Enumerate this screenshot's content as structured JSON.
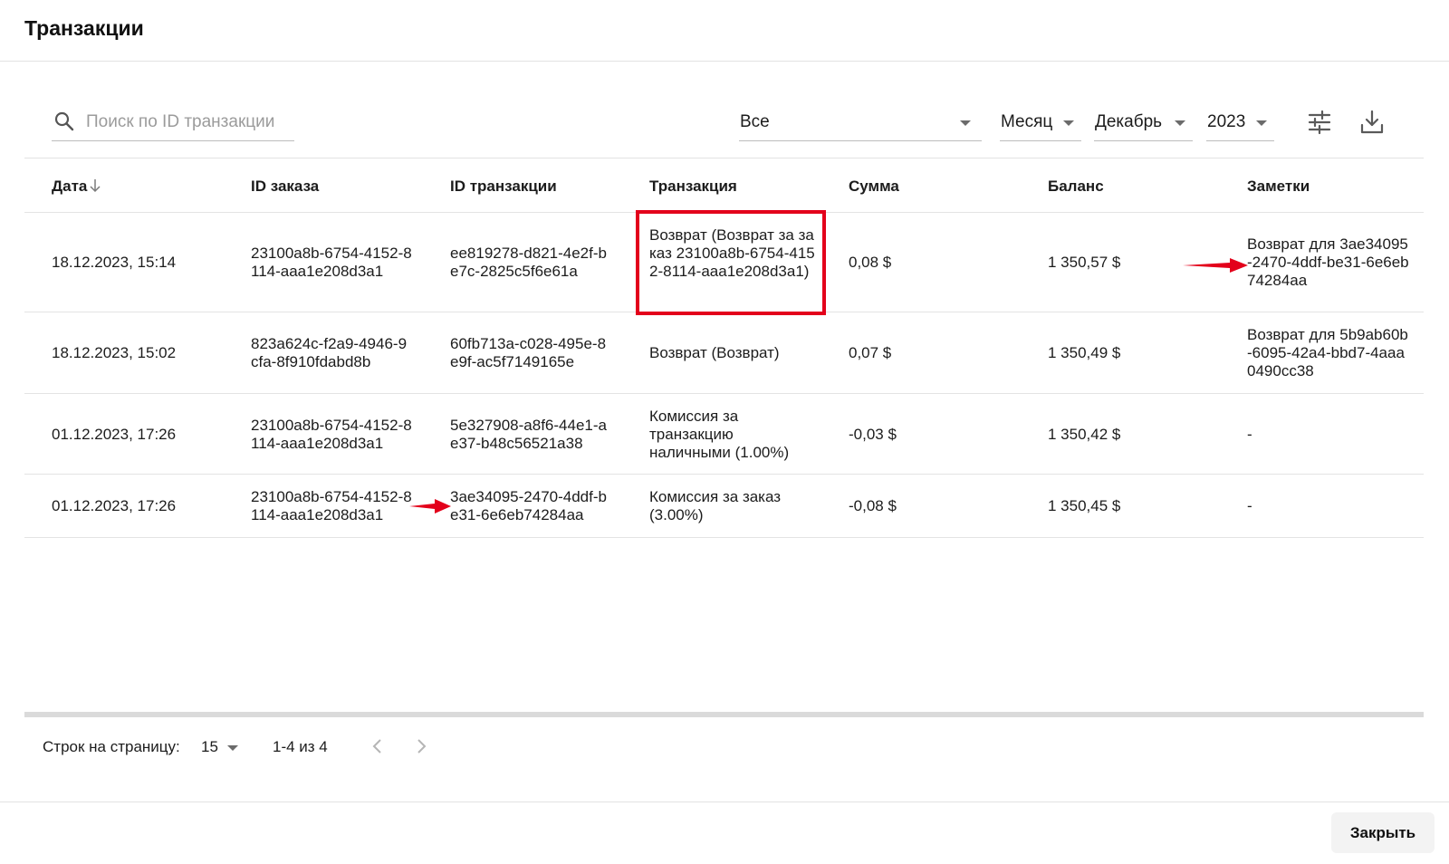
{
  "window": {
    "title": "Транзакции"
  },
  "filters": {
    "search_placeholder": "Поиск по ID транзакции",
    "search_value": "",
    "type": "Все",
    "period": "Месяц",
    "month": "Декабрь",
    "year": "2023"
  },
  "icons": {
    "search": "search-icon",
    "filter": "tune-icon",
    "download": "download-icon",
    "sort": "arrow-down-icon",
    "prev": "chevron-left-icon",
    "next": "chevron-right-icon"
  },
  "table": {
    "columns": [
      "Дата",
      "ID заказа",
      "ID транзакции",
      "Транзакция",
      "Сумма",
      "Баланс",
      "Заметки"
    ],
    "rows": [
      {
        "date": "18.12.2023, 15:14",
        "order_id": "23100a8b-6754-4152-8114-aaa1e208d3a1",
        "tx_id": "ee819278-d821-4e2f-be7c-2825c5f6e61a",
        "type": "Возврат (Возврат за заказ 23100a8b-6754-4152-8114-aaa1e208d3a1)",
        "amount": "0,08 $",
        "balance": "1 350,57 $",
        "notes": "Возврат для 3ae34095-2470-4ddf-be31-6e6eb74284aa"
      },
      {
        "date": "18.12.2023, 15:02",
        "order_id": "823a624c-f2a9-4946-9cfa-8f910fdabd8b",
        "tx_id": "60fb713a-c028-495e-8e9f-ac5f7149165e",
        "type": "Возврат (Возврат)",
        "amount": "0,07 $",
        "balance": "1 350,49 $",
        "notes": "Возврат для 5b9ab60b-6095-42a4-bbd7-4aaa0490cc38"
      },
      {
        "date": "01.12.2023, 17:26",
        "order_id": "23100a8b-6754-4152-8114-aaa1e208d3a1",
        "tx_id": "5e327908-a8f6-44e1-ae37-b48c56521a38",
        "type": "Комиссия за транзакцию наличными (1.00%)",
        "amount": "-0,03 $",
        "balance": "1 350,42 $",
        "notes": "-"
      },
      {
        "date": "01.12.2023, 17:26",
        "order_id": "23100a8b-6754-4152-8114-aaa1e208d3a1",
        "tx_id": "3ae34095-2470-4ddf-be31-6e6eb74284aa",
        "type": "Комиссия за заказ (3.00%)",
        "amount": "-0,08 $",
        "balance": "1 350,45 $",
        "notes": "-"
      }
    ]
  },
  "pagination": {
    "rows_label": "Строк на страницу:",
    "rows_per_page": "15",
    "range": "1-4 из 4"
  },
  "footer": {
    "close_label": "Закрыть"
  },
  "colors": {
    "annotation_red": "#e3001b",
    "divider": "#e3e3e3"
  }
}
